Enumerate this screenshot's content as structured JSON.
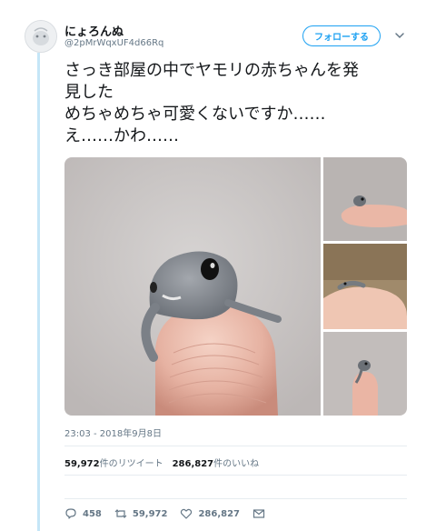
{
  "user": {
    "display_name": "にょろんぬ",
    "username": "@2pMrWqxUF4d66Rq"
  },
  "follow_label": "フォローする",
  "tweet": {
    "lines": [
      "さっき部屋の中でヤモリの赤ちゃんを発",
      "見した",
      "めちゃめちゃ可愛くないですか……",
      "え……かわ……"
    ]
  },
  "media": {
    "photos": [
      "gecko-closeup-on-fingertip",
      "gecko-on-fingertip-top",
      "gecko-on-fingertip-middle",
      "gecko-on-fingertip-bottom"
    ]
  },
  "timestamp": "23:03 - 2018年9月8日",
  "stats": {
    "retweets_count": "59,972",
    "retweets_label": "件のリツイート",
    "likes_count": "286,827",
    "likes_label": "件のいいね"
  },
  "actions": {
    "reply_count": "458",
    "retweet_count": "59,972",
    "like_count": "286,827"
  },
  "colors": {
    "accent": "#1da1f2",
    "thread_line": "#c5e6f7",
    "muted_text": "#657786"
  },
  "icons": [
    "chevron-down-icon",
    "reply-icon",
    "retweet-icon",
    "heart-icon",
    "mail-icon"
  ]
}
